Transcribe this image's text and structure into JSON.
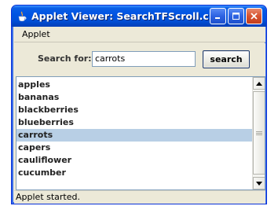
{
  "window": {
    "title": "Applet Viewer: SearchTFScroll.c...",
    "icon": "java-cup-icon",
    "buttons": [
      "minimize",
      "maximize",
      "close"
    ]
  },
  "menubar": {
    "items": [
      "Applet"
    ]
  },
  "search": {
    "label": "Search for:",
    "value": "carrots",
    "button_label": "search"
  },
  "list": {
    "items": [
      "apples",
      "bananas",
      "blackberries",
      "blueberries",
      "carrots",
      "capers",
      "cauliflower",
      "cucumber"
    ],
    "selected": "carrots"
  },
  "status": {
    "text": "Applet started."
  },
  "colors": {
    "titlebar": "#0054e3",
    "selection": "#b8cfe5",
    "window_bg": "#ece9d8"
  }
}
